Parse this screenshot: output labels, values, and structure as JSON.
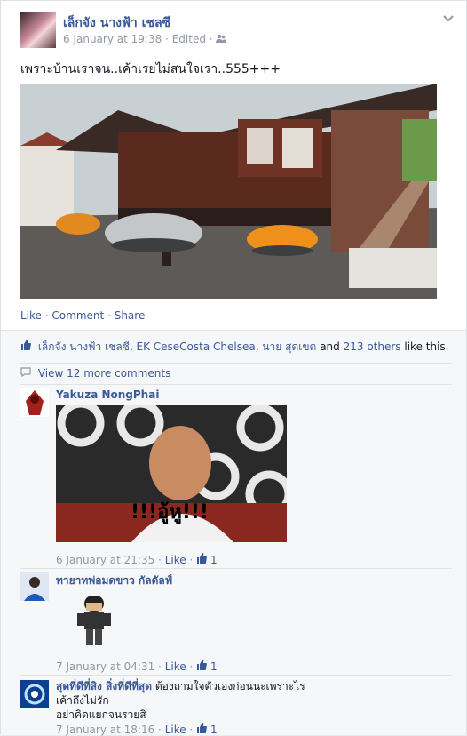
{
  "post": {
    "author": "เล็กจัง นางฟ้า เชลซี",
    "date": "6 January at 19:38",
    "sep": "·",
    "edited": "Edited",
    "text": "เพราะบ้านเราจน..เค้าเรยไม่สนใจเรา..555+++",
    "actions": {
      "like": "Like",
      "comment": "Comment",
      "share": "Share"
    }
  },
  "ufi": {
    "likers": [
      "เล็กจัง นางฟ้า เชลซี",
      "EK CeseCosta Chelsea",
      "นาย สุดเขต"
    ],
    "and_text": "and",
    "others": "213 others",
    "like_this": "like this.",
    "view_more": "View 12 more comments"
  },
  "comments": [
    {
      "name": "Yakuza NongPhai",
      "image_caption": "!!!อู้หู!!!",
      "date": "6 January at 21:35",
      "like": "Like",
      "likes": "1"
    },
    {
      "name": "ทายาทพ่อมดขาว กัลดัลฟ์",
      "date": "7 January at 04:31",
      "like": "Like",
      "likes": "1"
    },
    {
      "name": "สุดที่ดีที่สิง สิ่งที่ดีที่สุด",
      "text1": "ต้องถามใจตัวเองก่อนนะเพราะไร",
      "text2": "เค้าถึงไม่รัก",
      "text3": "อย่าคิดแยกจนรวยสิ",
      "date": "7 January at 18:16",
      "like": "Like",
      "likes": "1"
    }
  ],
  "colors": {
    "link": "#3b5998",
    "meta": "#9197a3",
    "bg": "#f6f7f9"
  },
  "icons": [
    "friends-icon",
    "chevron-down-icon",
    "thumbs-up-icon",
    "comment-bubble-icon"
  ]
}
